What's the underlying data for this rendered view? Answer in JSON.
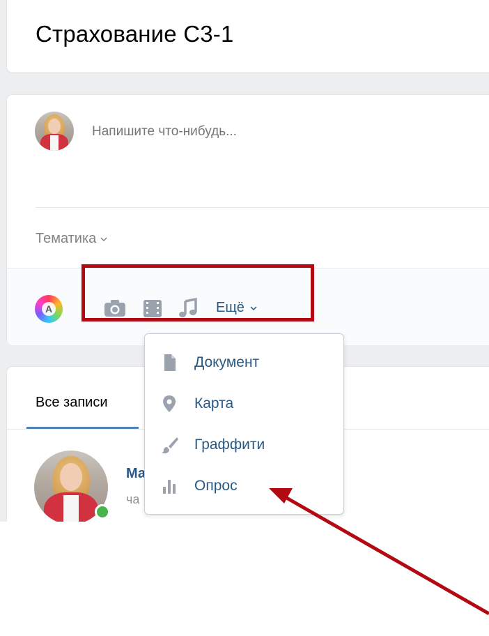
{
  "group": {
    "title": "Страхование С3-1"
  },
  "composer": {
    "placeholder": "Напишите что-нибудь...",
    "topic_label": "Тематика",
    "more_label": "Ещё",
    "tools": [
      "camera-icon",
      "video-icon",
      "music-icon"
    ]
  },
  "attach_menu": {
    "items": [
      {
        "label": "Документ",
        "icon": "document-icon"
      },
      {
        "label": "Карта",
        "icon": "map-pin-icon"
      },
      {
        "label": "Граффити",
        "icon": "brush-icon"
      },
      {
        "label": "Опрос",
        "icon": "poll-icon"
      }
    ]
  },
  "feed": {
    "tab_all": "Все записи",
    "post": {
      "author": "Ма",
      "time": "ча"
    }
  },
  "colors": {
    "link": "#2a5885",
    "highlight": "#b30912",
    "online": "#4bb34b",
    "tab_underline": "#5181b8"
  }
}
